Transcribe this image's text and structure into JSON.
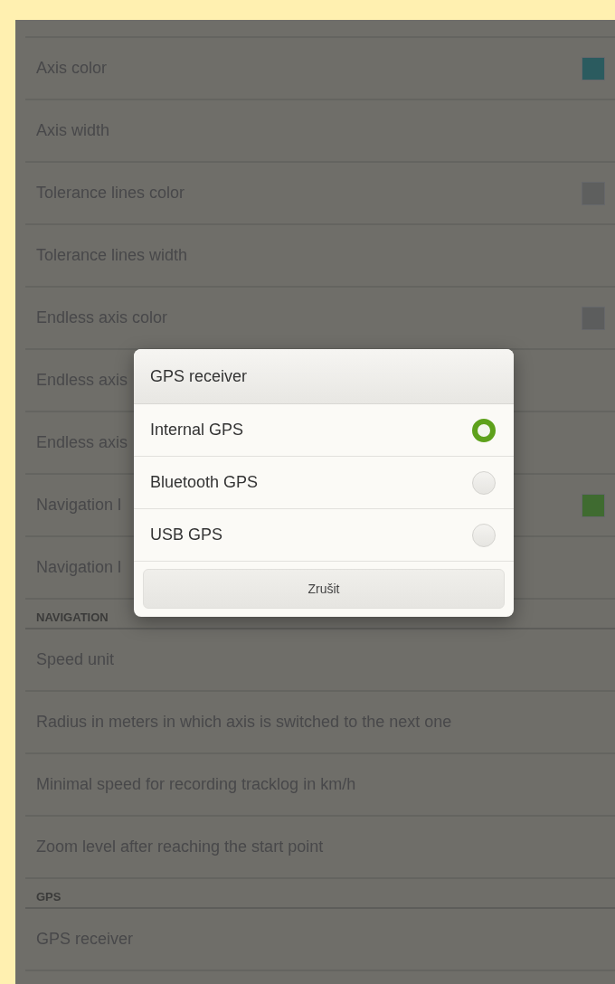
{
  "settings": [
    {
      "kind": "item",
      "label": "Axis color",
      "color": "#2b5b5f"
    },
    {
      "kind": "item",
      "label": "Axis width"
    },
    {
      "kind": "item",
      "label": "Tolerance lines color",
      "color": "#5e5f5e"
    },
    {
      "kind": "item",
      "label": "Tolerance lines width"
    },
    {
      "kind": "item",
      "label": "Endless axis color",
      "color": "#5c5d5d"
    },
    {
      "kind": "item",
      "label": "Endless axis"
    },
    {
      "kind": "item",
      "label": "Endless axis"
    },
    {
      "kind": "item",
      "label": "Navigation l",
      "color": "#3f6b30"
    },
    {
      "kind": "item",
      "label": "Navigation l"
    },
    {
      "kind": "header",
      "label": "NAVIGATION"
    },
    {
      "kind": "item",
      "label": "Speed unit"
    },
    {
      "kind": "item",
      "label": "Radius in meters in which axis is switched to the next one"
    },
    {
      "kind": "item",
      "label": "Minimal speed for recording tracklog in km/h"
    },
    {
      "kind": "item",
      "label": "Zoom level after reaching the start point"
    },
    {
      "kind": "header",
      "label": "GPS"
    },
    {
      "kind": "item",
      "label": "GPS receiver"
    }
  ],
  "dialog": {
    "title": "GPS receiver",
    "options": [
      {
        "label": "Internal GPS",
        "selected": true
      },
      {
        "label": "Bluetooth GPS",
        "selected": false
      },
      {
        "label": "USB GPS",
        "selected": false
      }
    ],
    "button": "Zrušit"
  }
}
